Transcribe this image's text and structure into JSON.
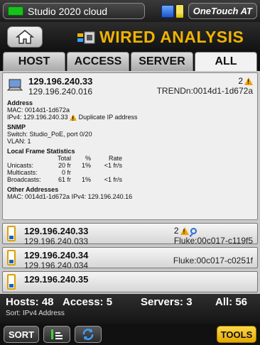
{
  "status": {
    "network": "Studio 2020 cloud",
    "brand": "OneTouch AT",
    "link_color": "#17c21c"
  },
  "title": {
    "text": "WIRED ANALYSIS",
    "home_icon": "home-icon",
    "accent": "#f0b400"
  },
  "tabs": [
    {
      "label": "HOST",
      "active": false
    },
    {
      "label": "ACCESS",
      "active": false
    },
    {
      "label": "SERVER",
      "active": false
    },
    {
      "label": "ALL",
      "active": true
    }
  ],
  "expanded_host": {
    "ip": "129.196.240.33",
    "name": "129.196.240.016",
    "warning_count": "2",
    "vendor": "TRENDn:0014d1-1d672a",
    "address_heading": "Address",
    "mac": "MAC: 0014d1-1d672a",
    "ipv4": "IPv4: 129.196.240.33",
    "ipv4_warning": "Duplicate IP address",
    "snmp_heading": "SNMP",
    "snmp_switch": "Switch: Studio_PoE, port 0/20",
    "snmp_vlan": "VLAN: 1",
    "stats_heading": "Local Frame Statistics",
    "stats_headers": [
      "",
      "Total",
      "%",
      "Rate"
    ],
    "stats_rows": [
      {
        "label": "Unicasts:",
        "total": "20 fr",
        "pct": "1%",
        "rate": "<1 fr/s"
      },
      {
        "label": "Multicasts:",
        "total": "0 fr",
        "pct": "",
        "rate": ""
      },
      {
        "label": "Broadcasts:",
        "total": "61 fr",
        "pct": "1%",
        "rate": "<1 fr/s"
      }
    ],
    "other_heading": "Other Addresses",
    "other_line": "MAC: 0014d1-1d672a IPv4: 129.196.240.16"
  },
  "hosts": [
    {
      "ip": "129.196.240.33",
      "name": "129.196.240.033",
      "badge": "2",
      "vendor": "Fluke:00c017-c119f5"
    },
    {
      "ip": "129.196.240.34",
      "name": "129.196.240.034",
      "badge": "",
      "vendor": "Fluke:00c017-c0251f"
    },
    {
      "ip": "129.196.240.35",
      "name": "",
      "badge": "",
      "vendor": ""
    }
  ],
  "summary": {
    "hosts": "Hosts: 48",
    "access": "Access: 5",
    "servers": "Servers: 3",
    "all": "All: 56",
    "sort": "Sort: IPv4 Address"
  },
  "toolbar": {
    "sort_label": "SORT",
    "tools_label": "TOOLS",
    "tools_color": "#f0b400"
  }
}
